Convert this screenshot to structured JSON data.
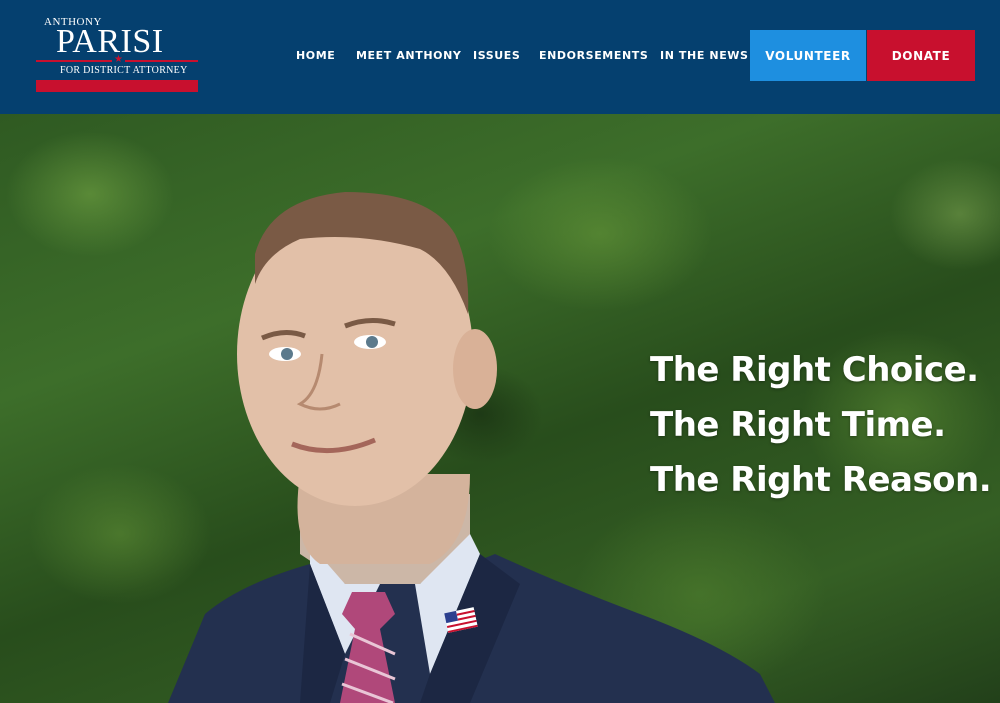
{
  "logo": {
    "first_name": "ANTHONY",
    "last_name": "PARISI",
    "subtitle": "FOR DISTRICT ATTORNEY",
    "star": "★"
  },
  "nav": {
    "items": [
      {
        "label": "HOME"
      },
      {
        "label": "MEET ANTHONY"
      },
      {
        "label": "ISSUES"
      },
      {
        "label": "ENDORSEMENTS"
      },
      {
        "label": "IN THE NEWS"
      }
    ],
    "volunteer_label": "VOLUNTEER",
    "donate_label": "DONATE"
  },
  "hero": {
    "tagline": [
      "The Right Choice.",
      "The Right Time.",
      "The Right Reason."
    ],
    "photo_icon": "candidate-portrait"
  },
  "colors": {
    "header_bg": "#05406f",
    "accent_red": "#c8102e",
    "accent_blue": "#1e8fe0"
  }
}
